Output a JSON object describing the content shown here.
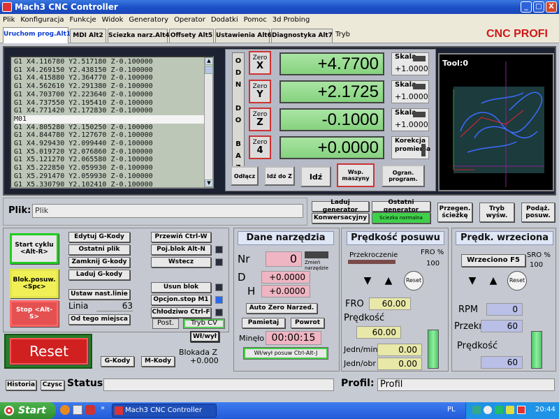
{
  "window": {
    "title": "Mach3 CNC Controller",
    "minimize": "_",
    "maximize": "□",
    "close": "X"
  },
  "menu": [
    "Plik",
    "Konfiguracja",
    "Funkcje",
    "Widok",
    "Generatory",
    "Operator",
    "Dodatki",
    "Pomoc",
    "3d Probing"
  ],
  "tabs": [
    "Uruchom prog.Alt1",
    "MDI Alt2",
    "Sciezka narz.Alt4",
    "Offsety Alt5",
    "Ustawienia Alt6",
    "Diagnostyka Alt7"
  ],
  "mode_label": "Tryb",
  "brand": "CNC PROFI",
  "gcode_lines": [
    "G1 X4.116780 Y2.517180 Z-0.100000",
    "G1 X4.269150 Y2.438150 Z-0.100000",
    "G1 X4.415880 Y2.364770 Z-0.100000",
    "G1 X4.562610 Y2.291380 Z-0.100000",
    "G1 X4.703700 Y2.223640 Z-0.100000",
    "G1 X4.737550 Y2.195410 Z-0.100000",
    "G1 X4.771420 Y2.172830 Z-0.100000",
    "M01",
    "G1 X4.805280 Y2.150250 Z-0.100000",
    "G1 X4.844780 Y2.127670 Z-0.100000",
    "G1 X4.929430 Y2.099440 Z-0.100000",
    "G1 X5.019720 Y2.076860 Z-0.100000",
    "G1 X5.121270 Y2.065580 Z-0.100000",
    "G1 X5.222850 Y2.059930 Z-0.100000",
    "G1 X5.291470 Y2.059930 Z-0.100000",
    "G1 X5.330790 Y2.102410 Z-0.100000"
  ],
  "gcode_highlight_index": 7,
  "odn_text": "ODN DO BAZY",
  "axes": [
    {
      "zero_label": "Zero",
      "axis": "X",
      "value": "+4.7700",
      "scale_label": "Skala",
      "scale": "+1.0000"
    },
    {
      "zero_label": "Zero",
      "axis": "Y",
      "value": "+2.1725",
      "scale_label": "Skala",
      "scale": "+1.0000"
    },
    {
      "zero_label": "Zero",
      "axis": "Z",
      "value": "-0.1000",
      "scale_label": "Skala",
      "scale": "+1.0000"
    },
    {
      "zero_label": "Zero",
      "axis": "4",
      "value": "+0.0000",
      "scale_label": "Korekcja promienia",
      "scale": ""
    }
  ],
  "dro_buttons": [
    "Odłącz",
    "Idź do Z",
    "Idź",
    "Wsp. maszyny",
    "Ogran. program."
  ],
  "tool": {
    "label": "Tool:0"
  },
  "file": {
    "label": "Plik:",
    "value": "Plik"
  },
  "gen_buttons": {
    "load": "Laduj generator",
    "last": "Ostatni generator",
    "conv": "Konwersacyjny",
    "green": "Sciezka normalna"
  },
  "view_buttons": [
    "Przegen. ścieżkę",
    "Tryb wyśw.",
    "Podąż. posuw."
  ],
  "cycle": {
    "start": "Start cyklu <Alt-R>",
    "feedhold": "Blok.posuw. <Spc>",
    "stop": "Stop <Alt-S>",
    "reset": "Reset"
  },
  "edit_buttons": [
    "Edytuj G-Kody",
    "Ostatni plik",
    "Zamknij G-kody",
    "Laduj G-kody",
    "Ustaw nast.linie",
    "Od tego miejsca"
  ],
  "line": {
    "label": "Linia",
    "value": "63"
  },
  "right_buttons": [
    "Przewiń Ctrl-W",
    "Poj.blok Alt-N",
    "Wstecz",
    "Usun blok",
    "Opcjon.stop M1",
    "Chłodziwo Ctrl-F"
  ],
  "post_label": "Post.",
  "trybcv_label": "Tryb CV",
  "wlwyl": {
    "label": "Wł/wył",
    "blokada": "Blokada Z",
    "value": "+0.000"
  },
  "gm_buttons": [
    "G-Kody",
    "M-Kody"
  ],
  "tool_data": {
    "title": "Dane narzędzia",
    "nr_label": "Nr",
    "nr_value": "0",
    "change_label": "Zmień narzędzie",
    "d_label": "D",
    "d_value": "+0.0000",
    "h_label": "H",
    "h_value": "+0.0000",
    "auto_zero": "Auto Zero Narzed.",
    "remember": "Pamietaj",
    "return": "Powrot",
    "time_label": "Minęło",
    "time_value": "00:00:15",
    "jog_button": "Wł/wył posuw Ctrl-Alt-J"
  },
  "feed": {
    "title": "Prędkość posuwu",
    "override_label": "Przekroczenie",
    "fro_pct_label": "FRO %",
    "fro_pct": "100",
    "reset": "Reset",
    "fro_label": "FRO",
    "fro_value": "60.00",
    "speed_label": "Prędkość",
    "speed_value": "60.00",
    "per_min_label": "Jedn/min",
    "per_min": "0.00",
    "per_rev_label": "Jedn/obr",
    "per_rev": "0.00"
  },
  "spindle": {
    "title": "Prędk. wrzeciona",
    "toggle": "Wrzeciono F5",
    "sro_label": "SRO %",
    "sro": "100",
    "reset": "Reset",
    "rpm_label": "RPM",
    "rpm": "0",
    "override_label": "Przekr",
    "override": "60",
    "speed_label": "Prędkość",
    "speed": "60"
  },
  "status": {
    "history": "Historia",
    "clear": "Czysc",
    "label": "Status:",
    "value": "",
    "profile_label": "Profil:",
    "profile": "Profil"
  },
  "taskbar": {
    "start": "Start",
    "task": "Mach3 CNC Controller",
    "lang": "PL",
    "time": "20:44"
  },
  "colors": {
    "title": "#1a4fc6",
    "dro_green": "#86d27f",
    "reset_red": "#d02020",
    "brand_red": "#d01818"
  }
}
